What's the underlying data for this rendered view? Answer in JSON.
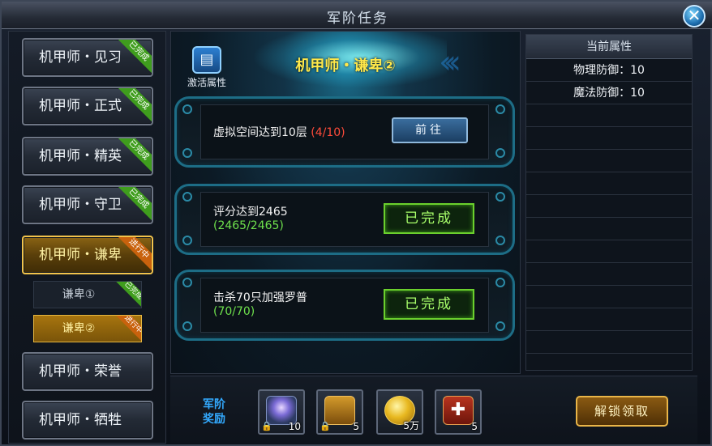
{
  "window": {
    "title": "军阶任务",
    "close_glyph": "✕"
  },
  "sidebar": {
    "ranks": [
      {
        "label": "机甲师・见习",
        "status": "已完成"
      },
      {
        "label": "机甲师・正式",
        "status": "已完成"
      },
      {
        "label": "机甲师・精英",
        "status": "已完成"
      },
      {
        "label": "机甲师・守卫",
        "status": "已完成"
      },
      {
        "label": "机甲师・谦卑",
        "status": "进行中"
      },
      {
        "label": "机甲师・荣誉",
        "status": ""
      },
      {
        "label": "机甲师・牺牲",
        "status": ""
      }
    ],
    "subs": [
      {
        "label": "谦卑①",
        "status": "已完成"
      },
      {
        "label": "谦卑②",
        "status": "进行中"
      }
    ]
  },
  "main": {
    "activate_label": "激活属性",
    "task_title": "机甲师・谦卑②",
    "tasks": [
      {
        "desc": "虚拟空间达到10层",
        "progress": "(4/10)",
        "button": "前往"
      },
      {
        "desc": "评分达到2465",
        "progress": "(2465/2465)",
        "button": "已完成"
      },
      {
        "desc": "击杀70只加强罗普",
        "progress": "(70/70)",
        "button": "已完成"
      }
    ]
  },
  "attributes": {
    "header": "当前属性",
    "rows": [
      "物理防御：10",
      "魔法防御：10"
    ]
  },
  "rewards": {
    "label_line1": "军阶",
    "label_line2": "奖励",
    "items": [
      {
        "icon": "mech-core-icon",
        "qty": "10",
        "locked": true
      },
      {
        "icon": "treasure-chest-icon",
        "qty": "5",
        "locked": true
      },
      {
        "icon": "gold-coins-icon",
        "qty": "5万",
        "locked": false
      },
      {
        "icon": "red-card-icon",
        "qty": "5",
        "locked": false
      }
    ],
    "unlock_label": "解锁领取"
  }
}
